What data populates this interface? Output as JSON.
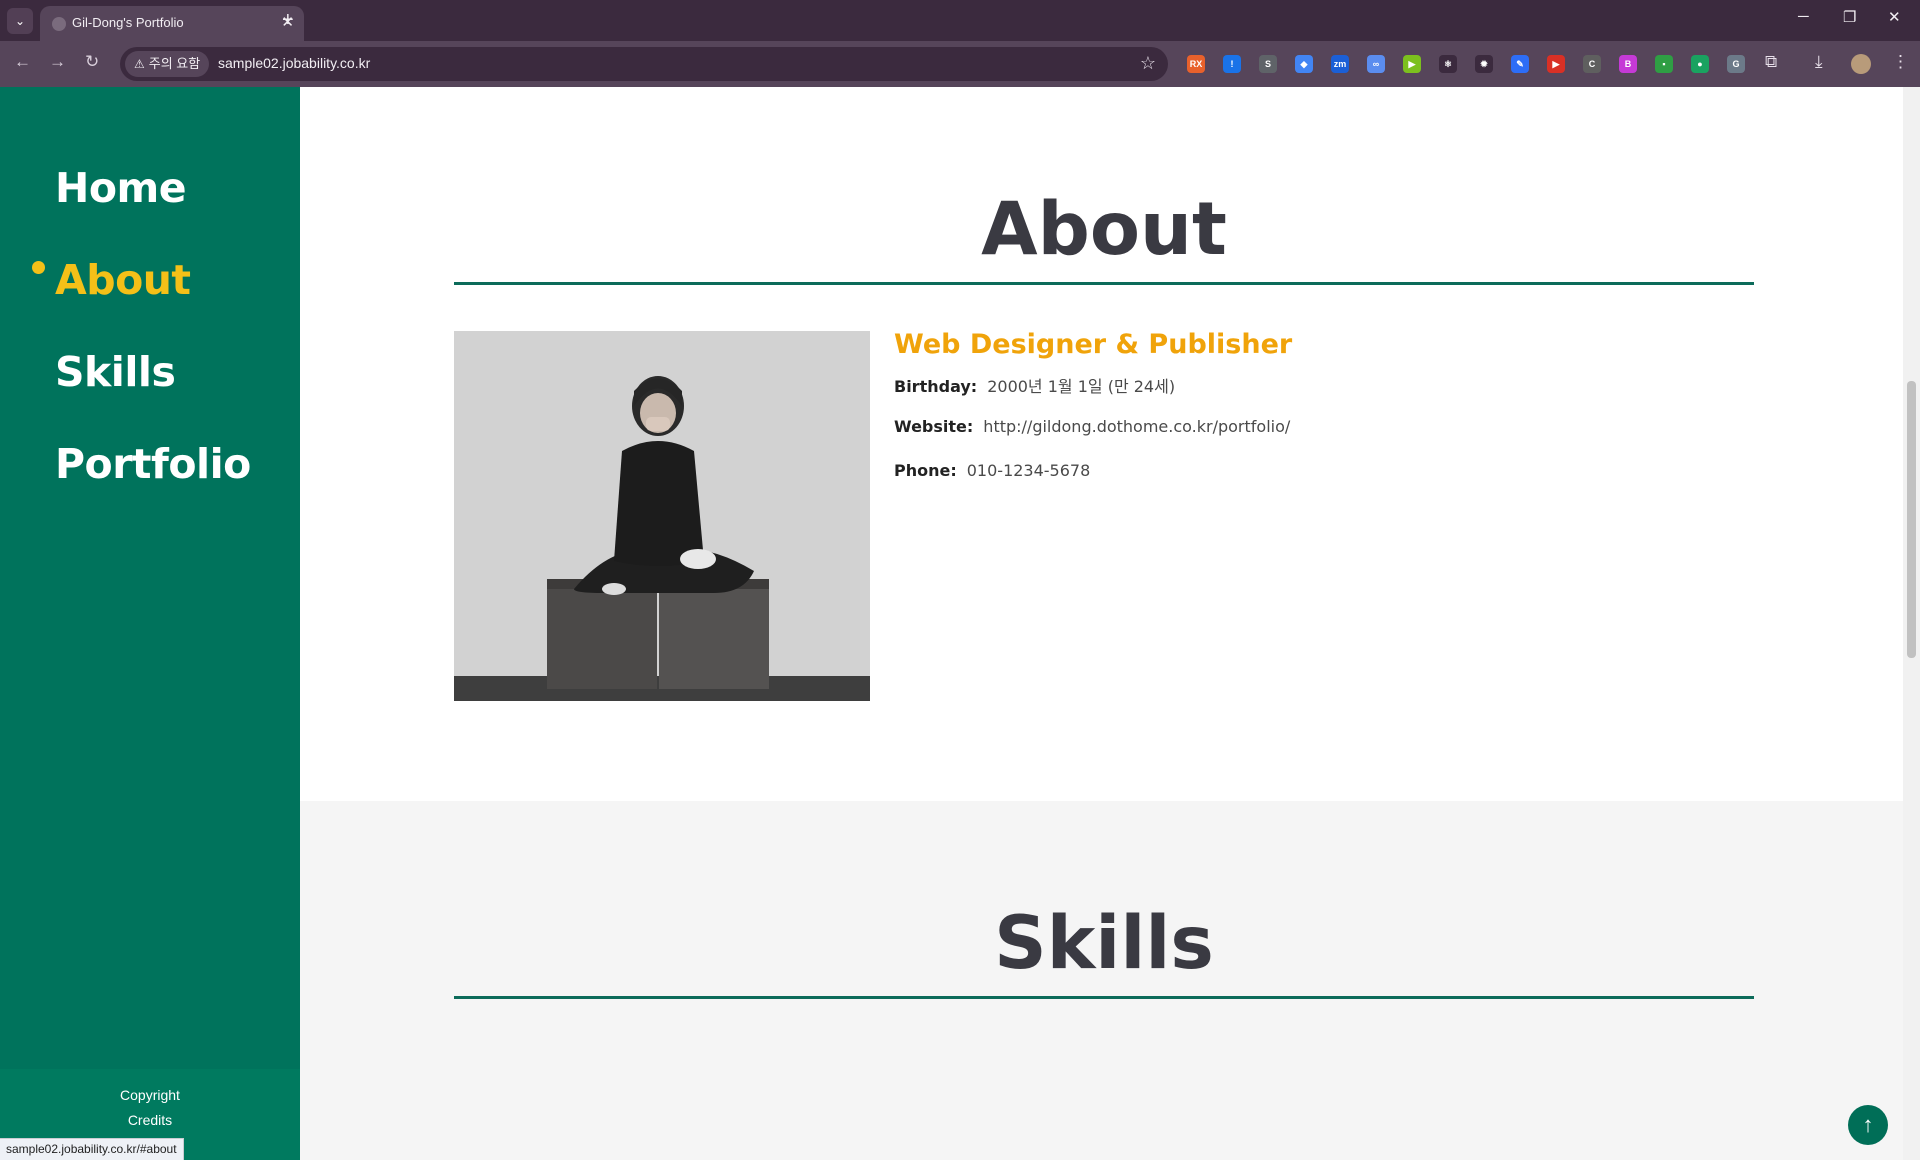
{
  "browser": {
    "tab_title": "Gil-Dong's Portfolio",
    "tab_close": "✕",
    "new_tab": "+",
    "security_chip": "주의 요함",
    "url": "sample02.jobability.co.kr",
    "status_url": "sample02.jobability.co.kr/#about",
    "extensions": [
      {
        "icon": "rx-ext-icon",
        "label": "RX",
        "color": "#e8612c"
      },
      {
        "icon": "info-ext-icon",
        "label": "!",
        "color": "#1a73e8"
      },
      {
        "icon": "s-ext-icon",
        "label": "S",
        "color": "#5f6368"
      },
      {
        "icon": "drop-ext-icon",
        "label": "◆",
        "color": "#4285f4"
      },
      {
        "icon": "zm-ext-icon",
        "label": "zm",
        "color": "#1b5fd6"
      },
      {
        "icon": "link-ext-icon",
        "label": "∞",
        "color": "#5b8def"
      },
      {
        "icon": "play-ext-icon",
        "label": "▶",
        "color": "#7cc01e"
      },
      {
        "icon": "react-ext-icon",
        "label": "⚛",
        "color": "#3b2a3e"
      },
      {
        "icon": "gear-ext-icon",
        "label": "✹",
        "color": "#3b2a3e"
      },
      {
        "icon": "pen-ext-icon",
        "label": "✎",
        "color": "#2d6df6"
      },
      {
        "icon": "video-ext-icon",
        "label": "▶",
        "color": "#d93025"
      },
      {
        "icon": "ci-ext-icon",
        "label": "C",
        "color": "#5f5f5f"
      },
      {
        "icon": "tb-ext-icon",
        "label": "B",
        "color": "#c53ad6"
      },
      {
        "icon": "card-ext-icon",
        "label": "▪",
        "color": "#2f9e44"
      },
      {
        "icon": "chat-ext-icon",
        "label": "●",
        "color": "#1aa260"
      },
      {
        "icon": "translate-ext-icon",
        "label": "G",
        "color": "#6c7a89"
      }
    ]
  },
  "sidebar": {
    "items": [
      {
        "label": "Home",
        "active": false
      },
      {
        "label": "About",
        "active": true
      },
      {
        "label": "Skills",
        "active": false
      },
      {
        "label": "Portfolio",
        "active": false
      }
    ],
    "footer": {
      "copyright": "Copyright",
      "credits": "Credits"
    }
  },
  "about": {
    "title": "About",
    "role": "Web Designer & Publisher",
    "birthday_label": "Birthday:",
    "birthday_value": "2000년 1월 1일 (만 24세)",
    "website_label": "Website:",
    "website_value": "http://gildong.dothome.co.kr/portfolio/",
    "phone_label": "Phone:",
    "phone_value": "010-1234-5678"
  },
  "skills": {
    "title": "Skills"
  },
  "colors": {
    "sidebar": "#00735c",
    "accent_yellow": "#f4c018",
    "role_orange": "#f0a30a",
    "divider_green": "#0c6b5a",
    "heading": "#3a3a42"
  },
  "back_to_top_icon": "arrow-up-icon"
}
